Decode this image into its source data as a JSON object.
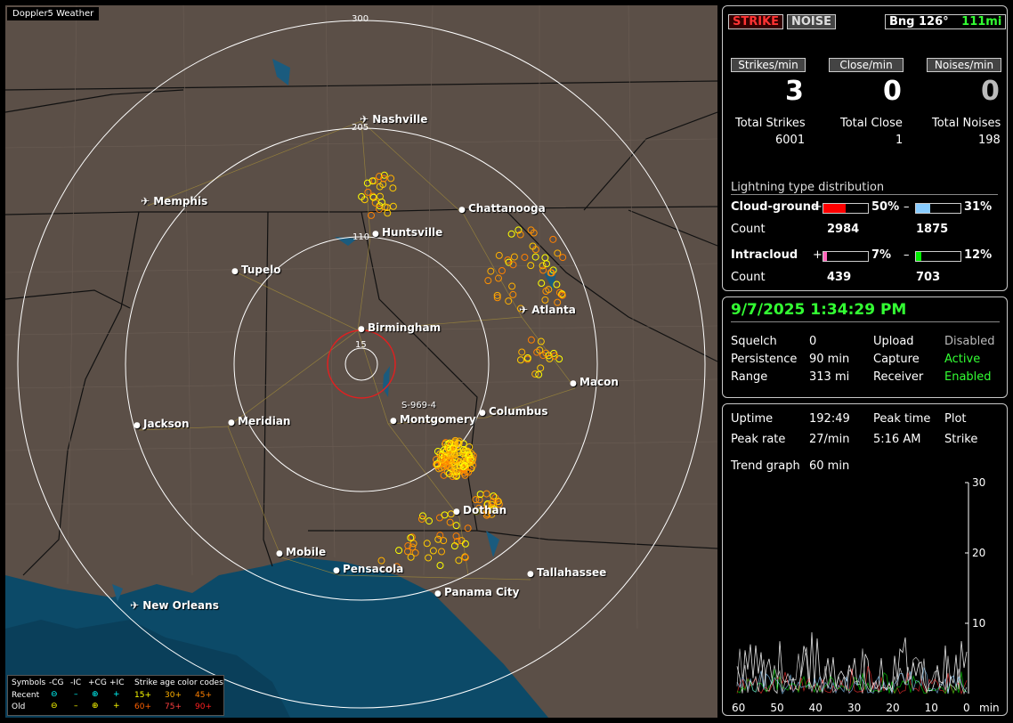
{
  "app_title": "Doppler5 Weather",
  "map": {
    "ring_labels": [
      "300",
      "205",
      "110",
      "15"
    ],
    "cities": [
      {
        "name": "Nashville",
        "icon": "airport"
      },
      {
        "name": "Memphis",
        "icon": "airport"
      },
      {
        "name": "Chattanooga",
        "icon": "dot"
      },
      {
        "name": "Huntsville",
        "icon": "dot"
      },
      {
        "name": "Tupelo",
        "icon": "dot"
      },
      {
        "name": "Birmingham",
        "icon": "dot"
      },
      {
        "name": "Atlanta",
        "icon": "airport"
      },
      {
        "name": "Macon",
        "icon": "dot"
      },
      {
        "name": "Jackson",
        "icon": "dot"
      },
      {
        "name": "Meridian",
        "icon": "dot"
      },
      {
        "name": "Montgomery",
        "icon": "dot"
      },
      {
        "name": "Columbus",
        "icon": "dot"
      },
      {
        "name": "Dothan",
        "icon": "dot"
      },
      {
        "name": "Mobile",
        "icon": "dot"
      },
      {
        "name": "Pensacola",
        "icon": "dot"
      },
      {
        "name": "Tallahassee",
        "icon": "dot"
      },
      {
        "name": "Panama City",
        "icon": "dot"
      },
      {
        "name": "New Orleans",
        "icon": "airport"
      }
    ],
    "station_label": "S-969-4",
    "legend": {
      "symbols_label": "Symbols",
      "col_cg_neg": "-CG",
      "col_ic_neg": "-IC",
      "col_cg_pos": "+CG",
      "col_ic_pos": "+IC",
      "age_label": "Strike age color codes",
      "recent_label": "Recent",
      "old_label": "Old",
      "recent_ages": [
        "15+",
        "30+",
        "45+"
      ],
      "old_ages": [
        "60+",
        "75+",
        "90+"
      ],
      "age_colors": [
        "#ffff00",
        "#ffb000",
        "#ff8000",
        "#ff6000",
        "#ff4040",
        "#ff2020"
      ]
    }
  },
  "status": {
    "strike_button": "STRIKE",
    "noise_button": "NOISE",
    "bearing": "Bng 126°",
    "distance": "111mi",
    "strikes_min_label": "Strikes/min",
    "close_min_label": "Close/min",
    "noises_min_label": "Noises/min",
    "strikes_min": "3",
    "close_min": "0",
    "noises_min": "0",
    "total_strikes_label": "Total Strikes",
    "total_close_label": "Total Close",
    "total_noises_label": "Total Noises",
    "total_strikes": "6001",
    "total_close": "1",
    "total_noises": "198",
    "dist_title": "Lightning type distribution",
    "cg_label": "Cloud-ground",
    "ic_label": "Intracloud",
    "count_label": "Count",
    "plus": "+",
    "minus": "–",
    "cg_pos_pct": "50%",
    "cg_neg_pct": "31%",
    "cg_pos_count": "2984",
    "cg_neg_count": "1875",
    "ic_pos_pct": "7%",
    "ic_neg_pct": "12%",
    "ic_pos_count": "439",
    "ic_neg_count": "703",
    "bar_values": {
      "cg_pos": 0.5,
      "cg_neg": 0.31,
      "ic_pos": 0.07,
      "ic_neg": 0.12
    },
    "bar_colors": {
      "cg_pos": "#ff0000",
      "cg_neg": "#88ccff",
      "ic_pos": "#ff66bb",
      "ic_neg": "#00ee00"
    }
  },
  "settings": {
    "datetime": "9/7/2025 1:34:29 PM",
    "squelch_label": "Squelch",
    "squelch": "0",
    "persistence_label": "Persistence",
    "persistence": "90 min",
    "range_label": "Range",
    "range": "313 mi",
    "upload_label": "Upload",
    "upload": "Disabled",
    "capture_label": "Capture",
    "capture": "Active",
    "receiver_label": "Receiver",
    "receiver": "Enabled"
  },
  "stats": {
    "uptime_label": "Uptime",
    "uptime": "192:49",
    "peak_time_label": "Peak time",
    "peak_time": "5:16 AM",
    "plot_label": "Plot",
    "plot": "Strike",
    "peak_rate_label": "Peak rate",
    "peak_rate": "27/min",
    "trend_label": "Trend graph",
    "trend": "60 min"
  },
  "chart_data": {
    "type": "line",
    "x_ticks": [
      "60",
      "50",
      "40",
      "30",
      "20",
      "10",
      "0"
    ],
    "x_unit": "min",
    "y_ticks": [
      "30",
      "20",
      "10"
    ],
    "ylim": [
      0,
      30
    ],
    "xlim": [
      60,
      0
    ]
  }
}
